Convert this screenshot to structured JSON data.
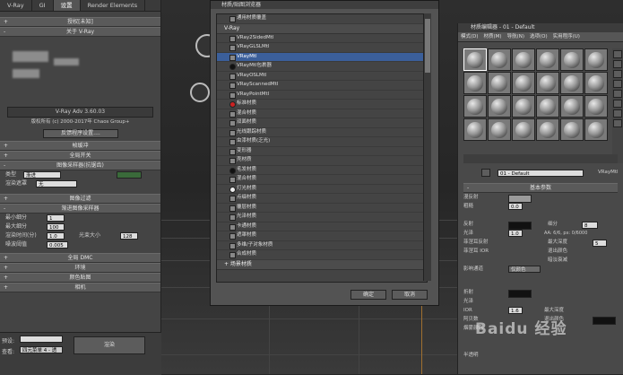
{
  "render_panel": {
    "tabs": [
      "V-Ray",
      "GI",
      "设置",
      "Render Elements"
    ],
    "rollouts": {
      "authorization": "授权[未知]",
      "about": "关于 V-Ray",
      "frame_buffer": "帧缓冲",
      "global_switches": "全局开关",
      "image_sampler": "图像采样器(抗锯齿)",
      "image_filter": "图像过滤",
      "bucket_sampler": "渐进图像采样器",
      "global_dmc": "全局 DMC",
      "environment": "环境",
      "color_mapping": "颜色贴图",
      "camera": "相机"
    },
    "version": "V-Ray Adv 3.60.03",
    "copyright": "版权所有 (c) 2000-2017年 Chaos Group+",
    "license_button": "反馈程序设置....",
    "sampler": {
      "type_label": "类型",
      "type_value": "渐进",
      "render_mask_label": "渲染遮罩",
      "render_mask_value": "无",
      "min_shading_label": "最小着色速率",
      "min_subdivs_label": "最小细分",
      "min_subdivs_value": "1",
      "max_subdivs_label": "最大细分",
      "max_subdivs_value": "100",
      "render_time_label": "渲染时间(分)",
      "render_time_value": "1.0",
      "ray_bundle_label": "光束大小",
      "ray_bundle_value": "128",
      "noise_threshold_label": "噪波阈值",
      "noise_threshold_value": "0.005"
    },
    "bottom": {
      "preset_label": "预设:",
      "view_label": "查看:",
      "view_value": "四元菜单 4 - 透",
      "render_button": "渲染"
    }
  },
  "browser": {
    "title": "材质/贴图浏览器",
    "top_item": "通用材质覆盖",
    "section_vray": "V-Ray",
    "items": [
      "VRay2SidedMtl",
      "VRayGLSLMtl",
      "VRayMtl",
      "VRayMtl包裹器",
      "VRayOSLMtl",
      "VRayScannedMtl",
      "VRayPointMtl",
      "标准材质",
      "混合材质",
      "双面材质",
      "光线跟踪材质",
      "虫漆材质(乏光)",
      "变形器",
      "壳材质",
      "毛发材质",
      "混合材质",
      "灯光材质",
      "点缀材质",
      "覆层材质",
      "光泽材质",
      "卡通材质",
      "遮罩材质",
      "多维/子对象材质",
      "合成材质"
    ],
    "selected_index": 2,
    "section_scene": "+ 场景材质",
    "ok_button": "确定",
    "cancel_button": "取消"
  },
  "material_editor": {
    "title": "材质编辑器 - 01 - Default",
    "menus": [
      "模式(D)",
      "材质(M)",
      "导航(N)",
      "选项(O)",
      "实用程序(U)"
    ],
    "material_name": "01 - Default",
    "material_type": "VRayMtl",
    "section_basic": "基本参数",
    "diffuse_label": "漫反射",
    "roughness_label": "粗糙",
    "roughness_value": "0.0",
    "reflect_label": "反射",
    "gloss_label": "光泽",
    "gloss_value": "1.0",
    "subdivs_label": "细分",
    "subdivs_value": "8",
    "max_depth_label": "最大深度",
    "max_depth_value": "5",
    "fresnel_label": "菲涅耳反射",
    "fresnel_ior_label": "菲涅耳 IOR",
    "exit_color_label": "退出颜色",
    "dim_falloff_label": "暗淡衰减",
    "refract_label": "折射",
    "refract_gloss_label": "光泽",
    "ior_label": "IOR",
    "ior_value": "1.6",
    "abbe_label": "阿贝数",
    "fog_color_label": "烟雾颜色",
    "aa_label": "AA: 6/6, px: 0/6000",
    "affect_channels_label": "影响通道",
    "affect_channels_value": "仅颜色",
    "translucency_label": "半透明"
  },
  "watermark": "Baidu 经验"
}
